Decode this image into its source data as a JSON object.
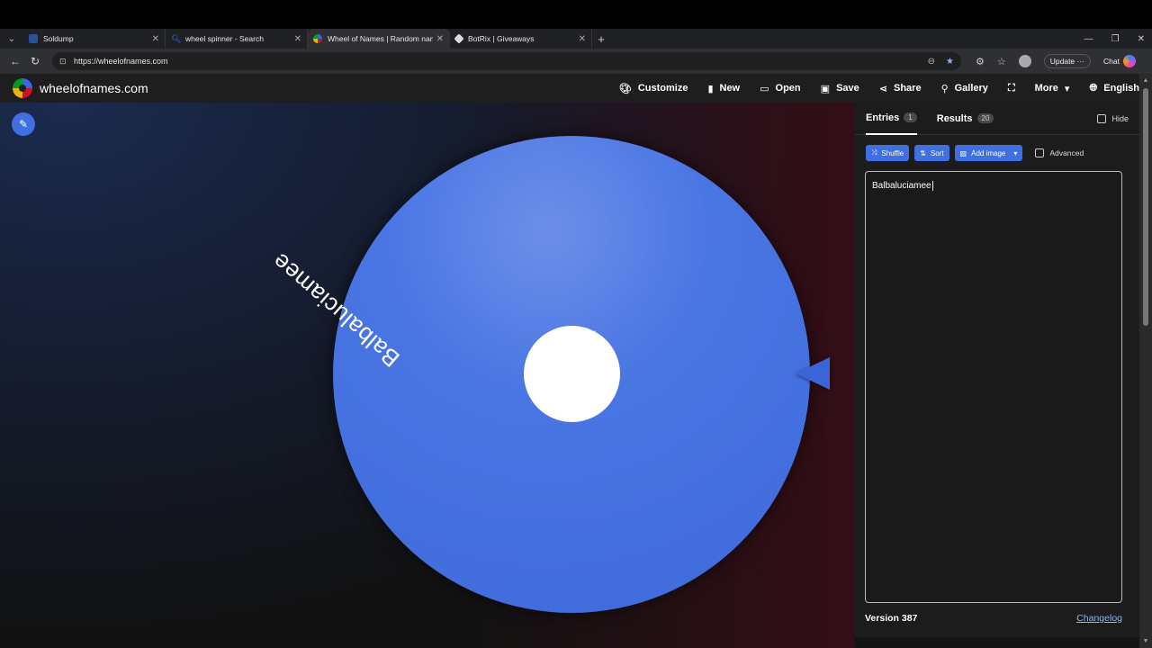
{
  "browser": {
    "tabs": [
      {
        "title": "Soldump",
        "favicon_color": "#2e4f9c",
        "active": false
      },
      {
        "title": "wheel spinner - Search",
        "favicon_color": "#3b82f6",
        "active": false
      },
      {
        "title": "Wheel of Names | Random name",
        "favicon_color": "#e23b3b",
        "active": true
      },
      {
        "title": "BotRix | Giveaways",
        "favicon_color": "#dddddd",
        "active": false
      }
    ],
    "url": "https://wheelofnames.com",
    "update_label": "Update",
    "chat_label": "Chat"
  },
  "app": {
    "brand": "wheelofnames.com",
    "menu": {
      "customize": "Customize",
      "new": "New",
      "open": "Open",
      "save": "Save",
      "share": "Share",
      "gallery": "Gallery",
      "more": "More",
      "language": "English"
    }
  },
  "wheel": {
    "segment_label": "Balbaluciamee",
    "segment_color": "#4a76e4"
  },
  "sidebar": {
    "entries_tab": "Entries",
    "entries_count": "1",
    "results_tab": "Results",
    "results_count": "20",
    "hide_label": "Hide",
    "shuffle_label": "Shuffle",
    "sort_label": "Sort",
    "add_image_label": "Add image",
    "advanced_label": "Advanced",
    "entries_text": "Balbaluciamee",
    "version": "Version 387",
    "changelog": "Changelog"
  }
}
